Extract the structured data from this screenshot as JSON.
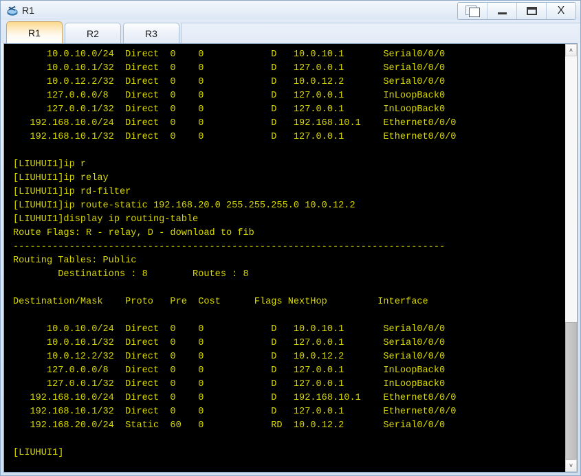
{
  "window": {
    "title": "R1",
    "icon": "router-icon",
    "controls": [
      {
        "name": "restore-window-button",
        "glyph": "restore-icon"
      },
      {
        "name": "minimize-window-button",
        "glyph": "minimize-icon"
      },
      {
        "name": "maximize-window-button",
        "glyph": "maximize-icon"
      },
      {
        "name": "close-window-button",
        "glyph": "close-icon",
        "label": "X"
      }
    ]
  },
  "tabs": [
    {
      "label": "R1",
      "active": true
    },
    {
      "label": "R2",
      "active": false
    },
    {
      "label": "R3",
      "active": false
    }
  ],
  "terminal": {
    "foreground": "#d9d900",
    "background": "#000000",
    "prompt": "[LIUHUI1]",
    "lines": [
      "      10.0.10.0/24  Direct  0    0            D   10.0.10.1       Serial0/0/0",
      "      10.0.10.1/32  Direct  0    0            D   127.0.0.1       Serial0/0/0",
      "      10.0.12.2/32  Direct  0    0            D   10.0.12.2       Serial0/0/0",
      "      127.0.0.0/8   Direct  0    0            D   127.0.0.1       InLoopBack0",
      "      127.0.0.1/32  Direct  0    0            D   127.0.0.1       InLoopBack0",
      "   192.168.10.0/24  Direct  0    0            D   192.168.10.1    Ethernet0/0/0",
      "   192.168.10.1/32  Direct  0    0            D   127.0.0.1       Ethernet0/0/0",
      "",
      "[LIUHUI1]ip r",
      "[LIUHUI1]ip relay",
      "[LIUHUI1]ip rd-filter",
      "[LIUHUI1]ip route-static 192.168.20.0 255.255.255.0 10.0.12.2",
      "[LIUHUI1]display ip routing-table",
      "Route Flags: R - relay, D - download to fib",
      "-----------------------------------------------------------------------------",
      "Routing Tables: Public",
      "        Destinations : 8        Routes : 8",
      "",
      "Destination/Mask    Proto   Pre  Cost      Flags NextHop         Interface",
      "",
      "      10.0.10.0/24  Direct  0    0            D   10.0.10.1       Serial0/0/0",
      "      10.0.10.1/32  Direct  0    0            D   127.0.0.1       Serial0/0/0",
      "      10.0.12.2/32  Direct  0    0            D   10.0.12.2       Serial0/0/0",
      "      127.0.0.0/8   Direct  0    0            D   127.0.0.1       InLoopBack0",
      "      127.0.0.1/32  Direct  0    0            D   127.0.0.1       InLoopBack0",
      "   192.168.10.0/24  Direct  0    0            D   192.168.10.1    Ethernet0/0/0",
      "   192.168.10.1/32  Direct  0    0            D   127.0.0.1       Ethernet0/0/0",
      "   192.168.20.0/24  Static  60   0            RD  10.0.12.2       Serial0/0/0",
      "",
      "[LIUHUI1]"
    ],
    "routing_table": {
      "flags_legend": "Route Flags: R - relay, D - download to fib",
      "scope": "Routing Tables: Public",
      "destinations": "8",
      "routes": "8",
      "columns": [
        "Destination/Mask",
        "Proto",
        "Pre",
        "Cost",
        "Flags",
        "NextHop",
        "Interface"
      ],
      "rows": [
        [
          "10.0.10.0/24",
          "Direct",
          "0",
          "0",
          "D",
          "10.0.10.1",
          "Serial0/0/0"
        ],
        [
          "10.0.10.1/32",
          "Direct",
          "0",
          "0",
          "D",
          "127.0.0.1",
          "Serial0/0/0"
        ],
        [
          "10.0.12.2/32",
          "Direct",
          "0",
          "0",
          "D",
          "10.0.12.2",
          "Serial0/0/0"
        ],
        [
          "127.0.0.0/8",
          "Direct",
          "0",
          "0",
          "D",
          "127.0.0.1",
          "InLoopBack0"
        ],
        [
          "127.0.0.1/32",
          "Direct",
          "0",
          "0",
          "D",
          "127.0.0.1",
          "InLoopBack0"
        ],
        [
          "192.168.10.0/24",
          "Direct",
          "0",
          "0",
          "D",
          "192.168.10.1",
          "Ethernet0/0/0"
        ],
        [
          "192.168.10.1/32",
          "Direct",
          "0",
          "0",
          "D",
          "127.0.0.1",
          "Ethernet0/0/0"
        ],
        [
          "192.168.20.0/24",
          "Static",
          "60",
          "0",
          "RD",
          "10.0.12.2",
          "Serial0/0/0"
        ]
      ]
    },
    "commands": [
      "ip r",
      "ip relay",
      "ip rd-filter",
      "ip route-static 192.168.20.0 255.255.255.0 10.0.12.2",
      "display ip routing-table"
    ]
  },
  "scrollbar": {
    "up_arrow": "˄",
    "down_arrow": "˅",
    "thumb_top_pct": 66,
    "thumb_height_pct": 34
  }
}
